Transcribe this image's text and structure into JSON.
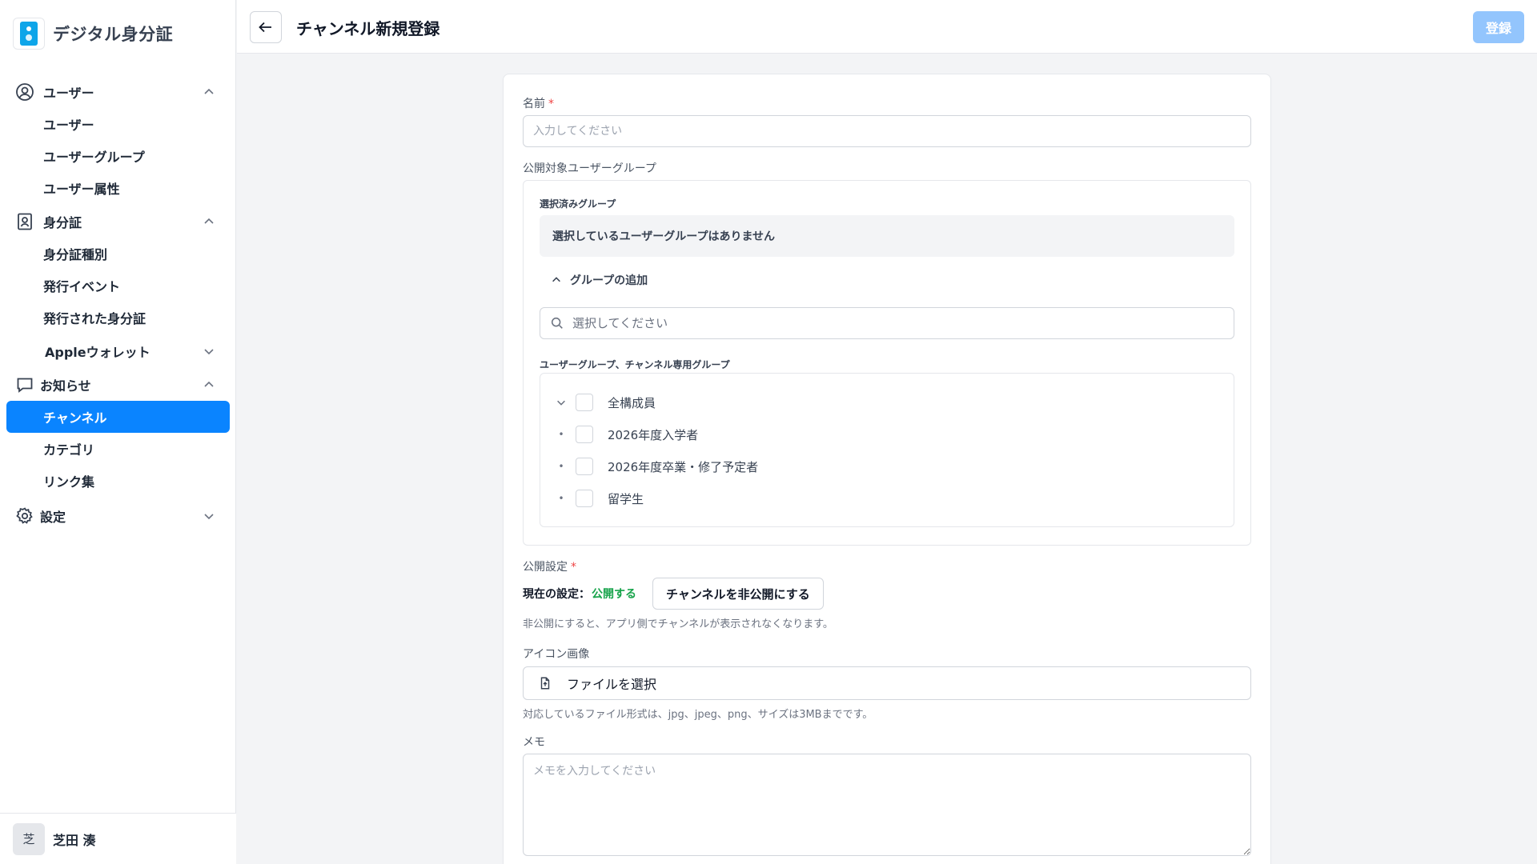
{
  "app": {
    "title": "デジタル身分証"
  },
  "sidebar": {
    "groups": [
      {
        "label": "ユーザー",
        "icon": "user-circle-icon",
        "items": [
          "ユーザー",
          "ユーザーグループ",
          "ユーザー属性"
        ]
      },
      {
        "label": "身分証",
        "icon": "id-card-icon",
        "items": [
          "身分証種別",
          "発行イベント",
          "発行された身分証",
          "Appleウォレット"
        ]
      },
      {
        "label": "お知らせ",
        "icon": "message-icon",
        "items": [
          "チャンネル",
          "カテゴリ",
          "リンク集"
        ]
      },
      {
        "label": "設定",
        "icon": "gear-icon",
        "items": []
      }
    ],
    "active_item": "チャンネル"
  },
  "user": {
    "avatar": "芝",
    "name": "芝田 湊"
  },
  "header": {
    "title": "チャンネル新規登録",
    "submit_label": "登録"
  },
  "form": {
    "name_label": "名前",
    "required_mark": "*",
    "name_placeholder": "入力してください",
    "target_groups_label": "公開対象ユーザーグループ",
    "selected_groups_label": "選択済みグループ",
    "selected_groups_empty": "選択しているユーザーグループはありません",
    "add_group_label": "グループの追加",
    "group_search_placeholder": "選択してください",
    "group_list_label": "ユーザーグループ、チャンネル専用グループ",
    "group_options": [
      "全構成員",
      "2026年度入学者",
      "2026年度卒業・修了予定者",
      "留学生"
    ],
    "visibility_label": "公開設定",
    "visibility_current_prefix": "現在の設定：",
    "visibility_current_value": "公開する",
    "visibility_toggle_label": "チャンネルを非公開にする",
    "visibility_help": "非公開にすると、アプリ側でチャンネルが表示されなくなります。",
    "icon_image_label": "アイコン画像",
    "file_select_label": "ファイルを選択",
    "file_help": "対応しているファイル形式は、jpg、jpeg、png、サイズは3MBまでです。",
    "memo_label": "メモ",
    "memo_placeholder": "メモを入力してください"
  },
  "colors": {
    "accent": "#0a84ff",
    "submit_disabled": "#93c5fd",
    "status_public": "#16a34a",
    "required": "#ef4444"
  }
}
